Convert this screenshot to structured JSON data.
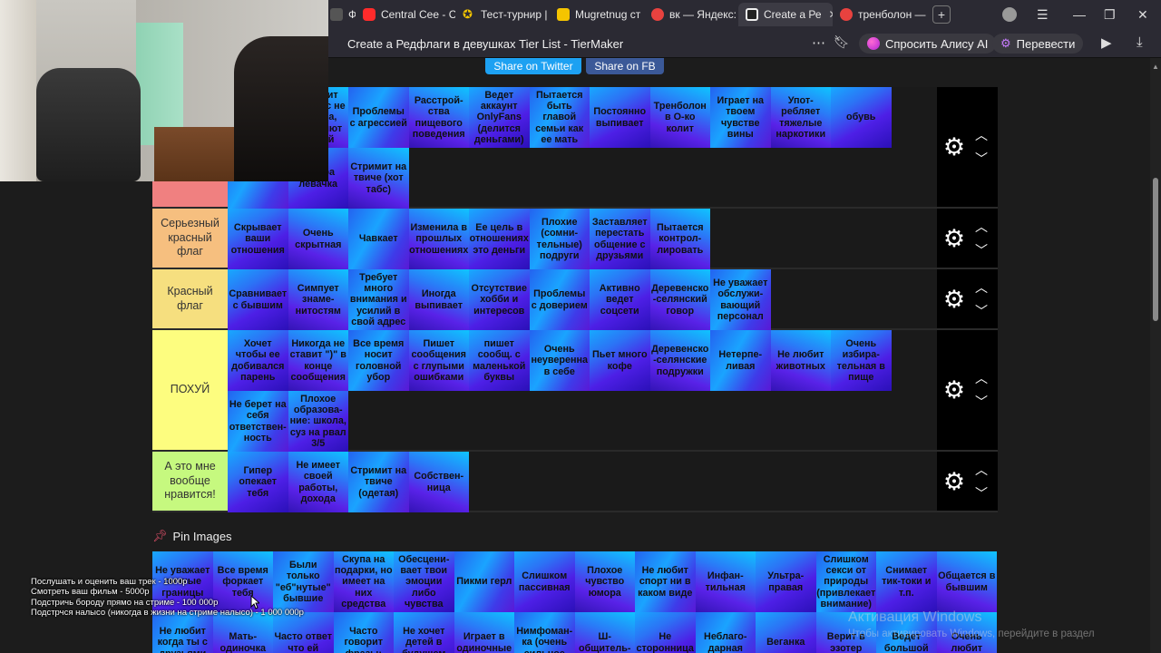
{
  "browser": {
    "tabs": [
      {
        "label": "ФЛ",
        "favicon_color": "#cccccc",
        "active": false
      },
      {
        "label": "Central Cee - С",
        "favicon_color": "#ff2b2b",
        "active": false
      },
      {
        "label": "Тест-турнир |",
        "favicon_color": "#f3c400",
        "active": false
      },
      {
        "label": "Mugretnug ст",
        "favicon_color": "#f5c400",
        "active": false
      },
      {
        "label": "вк — Яндекс:",
        "favicon_color": "#e8423f",
        "active": false
      },
      {
        "label": "Create a Ре",
        "favicon_color": "#ffffff",
        "active": true
      },
      {
        "label": "тренболон —",
        "favicon_color": "#e8423f",
        "active": false
      }
    ],
    "page_title": "Create a Редфлаги в девушках Tier List - TierMaker",
    "ask_alice_label": "Спросить Алису AI",
    "translate_label": "Перевести"
  },
  "share": {
    "twitter_label": "Share on Twitter",
    "fb_label": "Share on FB"
  },
  "tiers": [
    {
      "label": "",
      "color": "#f08080",
      "items": [
        "",
        "Говорит что секс не изменa, изменяют душой",
        "Проблемы с агрессией",
        "Расстрой-ства пищевого поведения",
        "Ведет аккаунт OnlyFans (делится деньгами)",
        "Пытается быть главой семьи как ее мать",
        "Постоянно выпивает",
        "Тренболон в О-ко колит",
        "Играет на твоем чувстве вины",
        "Упот-ребляет тяжелые наркотики",
        "обувь",
        "",
        "Ультра левачка",
        "Стримит на твиче (хот табс)"
      ]
    },
    {
      "label": "Серьезный красный флаг",
      "color": "#f6bf7f",
      "items": [
        "Скрывает ваши отношения",
        "Очень скрытная",
        "Чавкает",
        "Изменила в прошлых отношениях",
        "Ее цель в отношениях это деньги",
        "Плохие (сомни-тельные) подруги",
        "Заставляет перестать общение с друзьями",
        "Пытается контрол-лировать"
      ]
    },
    {
      "label": "Красный флаг",
      "color": "#f6df7f",
      "items": [
        "Сравнивает с бывшим",
        "Симпует знаме-нитостям",
        "Требует много внимания и усилий в свой адрес",
        "Иногда выпивает",
        "Отсутствие хобби и интересов",
        "Проблемы с доверием",
        "Активно ведет соцсети",
        "Деревенско -селянский говор",
        "Не уважает обслужи-вающий персонал"
      ]
    },
    {
      "label": "ПОХУЙ",
      "color": "#fdfd7f",
      "items": [
        "Хочет чтобы ее добивался парень",
        "Никогда не ставит \")\" в конце сообщения",
        "Все время носит головной убор",
        "Пишет сообщения с глупыми ошибками",
        "пишет сообщ. с маленькой буквы",
        "Очень неуверенна в себе",
        "Пьет много кофе",
        "Деревенско -селянские подружки",
        "Нетерпе-ливая",
        "Не любит животных",
        "Очень избира-тельная в пище",
        "Не берет на себя ответствен-ность",
        "Плохое образова-ние: школа, суз на рвал 3/5"
      ]
    },
    {
      "label": "А это мне вообще нравится!",
      "color": "#c6f97f",
      "items": [
        "Гипер опекает тебя",
        "Не имеет своей работы, дохода",
        "Стримит на твиче (одетая)",
        "Собствен-ница"
      ]
    }
  ],
  "pin_images_label": "Pin Images",
  "pool_items": [
    "Не уважает личные границы",
    "Все время форкает тебя",
    "Были только \"еб\"нутые\" бывшие",
    "Скупа на подарки, но имеет на них средства",
    "Обесцени-вает твои эмоции либо чувства",
    "Пикми герл",
    "Слишком пассивная",
    "Плохое чувство юмора",
    "Не любит спорт ни в каком виде",
    "Инфан-тильная",
    "Ультра-правая",
    "Слишком секси от природы (привлекает внимание)",
    "Снимает тик-токи и т.п.",
    "Общается в бывшим",
    "Не любит когда ты с друзьями",
    "Мать-одиночка",
    "Часто ответ чтo ей",
    "Часто говорит фразы:",
    "Не хочет детей в будущем",
    "Играет в одиночные",
    "Нимфоман-ка (очень сильное",
    "Ш-общитель-",
    "Не сторонница",
    "Неблаго-дарная",
    "Веганка",
    "Верит в эзотер",
    "Ведет большой",
    "Очень любит"
  ],
  "overlay": {
    "price_lines": [
      "Послушать и оценить ваш трек - 1000р",
      "Смотреть ваш фильм - 5000р",
      "Подстричь бороду прямо на стриме - 100 000р",
      "Подстрчся налысо (никогда в жизни на стриме налысо) - 1 000 000р"
    ],
    "watermark_title": "Активация Windows",
    "watermark_sub": "Чтобы активировать Windows, перейдите в раздел"
  },
  "colors": {
    "accent": "#1da1f2",
    "tile_gradient": [
      "#17a9ff",
      "#2c72f5",
      "#4d1fe6"
    ]
  },
  "icons": {
    "gear": "gear-icon",
    "up": "chevron-up-icon",
    "down": "chevron-down-icon",
    "pin": "pin-icon"
  }
}
